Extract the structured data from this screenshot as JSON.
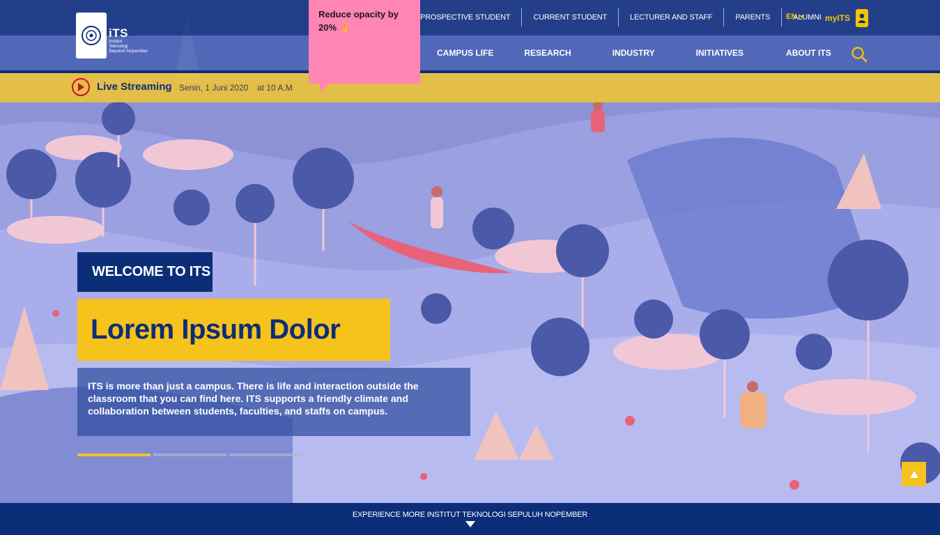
{
  "logo": {
    "title": "iTS",
    "subtitle_lines": [
      "Institut",
      "Teknologi",
      "Sepuluh Nopember"
    ]
  },
  "top_nav": {
    "links": [
      "PROSPECTIVE STUDENT",
      "CURRENT STUDENT",
      "LECTURER AND STAFF",
      "PARENTS",
      "ALUMNI"
    ],
    "language": "EN",
    "account_label": "myITS"
  },
  "main_nav": {
    "links": [
      "CAMPUS LIFE",
      "RESEARCH",
      "INDUSTRY",
      "INITIATIVES",
      "ABOUT ITS"
    ],
    "search_icon": "search-icon"
  },
  "tooltip": {
    "text": "Reduce opacity by 20% 👌"
  },
  "live": {
    "label": "Live Streaming",
    "date": "Senin, 1 Juni 2020",
    "time": "at 10 A.M"
  },
  "hero": {
    "welcome": "WELCOME TO ITS",
    "headline": "Lorem Ipsum Dolor",
    "description": "ITS is more than just a campus. There is life and interaction outside the classroom that you can find here. ITS supports a friendly climate and collaboration between students, faculties, and staffs on campus.",
    "slides": {
      "count": 3,
      "active": 1
    }
  },
  "footer": {
    "text": "EXPERIENCE MORE INSTITUT TEKNOLOGI SEPULUH NOPEMBER"
  },
  "colors": {
    "navy": "#0c2d78",
    "yellow": "#f6c21c",
    "pink_tooltip": "#ff86b4",
    "illustration_lavender": "#8f94d4"
  }
}
